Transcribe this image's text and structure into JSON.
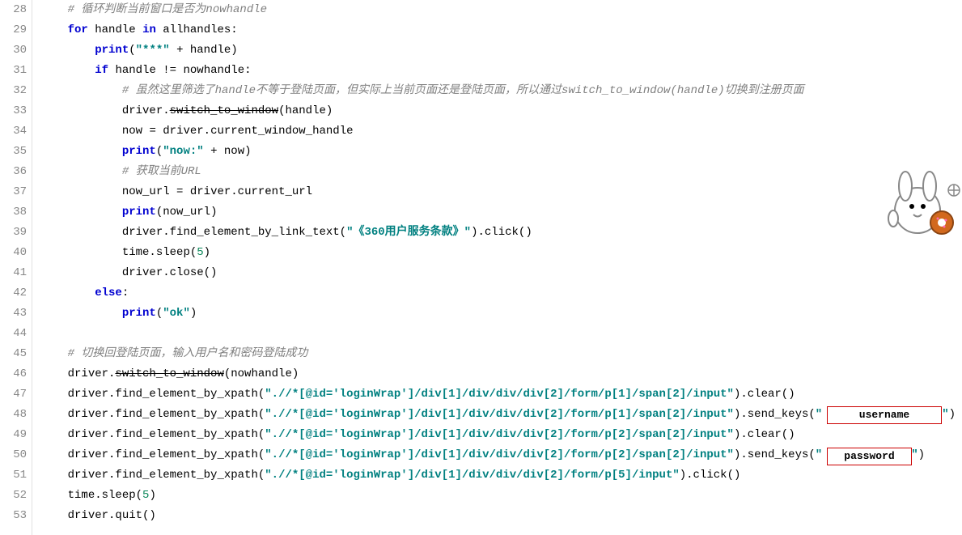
{
  "gutter_start": 28,
  "gutter_end": 53,
  "lines": {
    "l28": {
      "indent": 1,
      "tokens": [
        {
          "t": "comment",
          "v": "# 循环判断当前窗口是否为nowhandle"
        }
      ]
    },
    "l29": {
      "indent": 1,
      "tokens": [
        {
          "t": "kw",
          "v": "for"
        },
        {
          "t": "sp"
        },
        {
          "t": "ident",
          "v": "handle"
        },
        {
          "t": "sp"
        },
        {
          "t": "kw",
          "v": "in"
        },
        {
          "t": "sp"
        },
        {
          "t": "ident",
          "v": "allhandles:"
        }
      ]
    },
    "l30": {
      "indent": 2,
      "tokens": [
        {
          "t": "kw",
          "v": "print"
        },
        {
          "t": "paren",
          "v": "("
        },
        {
          "t": "str",
          "v": "\"***\""
        },
        {
          "t": "sp"
        },
        {
          "t": "op",
          "v": "+"
        },
        {
          "t": "sp"
        },
        {
          "t": "ident",
          "v": "handle"
        },
        {
          "t": "paren",
          "v": ")"
        }
      ]
    },
    "l31": {
      "indent": 2,
      "tokens": [
        {
          "t": "kw",
          "v": "if"
        },
        {
          "t": "sp"
        },
        {
          "t": "ident",
          "v": "handle"
        },
        {
          "t": "sp"
        },
        {
          "t": "op",
          "v": "!="
        },
        {
          "t": "sp"
        },
        {
          "t": "ident",
          "v": "nowhandle:"
        }
      ]
    },
    "l32": {
      "indent": 3,
      "tokens": [
        {
          "t": "comment",
          "v": "# 虽然这里筛选了handle不等于登陆页面，但实际上当前页面还是登陆页面，所以通过switch_to_window(handle)切换到注册页面"
        }
      ]
    },
    "l33": {
      "indent": 3,
      "tokens": [
        {
          "t": "ident",
          "v": "driver."
        },
        {
          "t": "strike",
          "v": "switch_to_window"
        },
        {
          "t": "paren",
          "v": "("
        },
        {
          "t": "ident",
          "v": "handle"
        },
        {
          "t": "paren",
          "v": ")"
        }
      ]
    },
    "l34": {
      "indent": 3,
      "tokens": [
        {
          "t": "ident",
          "v": "now"
        },
        {
          "t": "sp"
        },
        {
          "t": "op",
          "v": "="
        },
        {
          "t": "sp"
        },
        {
          "t": "ident",
          "v": "driver.current_window_handle"
        }
      ]
    },
    "l35": {
      "indent": 3,
      "tokens": [
        {
          "t": "kw",
          "v": "print"
        },
        {
          "t": "paren",
          "v": "("
        },
        {
          "t": "str",
          "v": "\"now:\""
        },
        {
          "t": "sp"
        },
        {
          "t": "op",
          "v": "+"
        },
        {
          "t": "sp"
        },
        {
          "t": "ident",
          "v": "now"
        },
        {
          "t": "paren",
          "v": ")"
        }
      ]
    },
    "l36": {
      "indent": 3,
      "tokens": [
        {
          "t": "comment",
          "v": "# 获取当前URL"
        }
      ]
    },
    "l37": {
      "indent": 3,
      "tokens": [
        {
          "t": "ident",
          "v": "now_url"
        },
        {
          "t": "sp"
        },
        {
          "t": "op",
          "v": "="
        },
        {
          "t": "sp"
        },
        {
          "t": "ident",
          "v": "driver.current_url"
        }
      ]
    },
    "l38": {
      "indent": 3,
      "tokens": [
        {
          "t": "kw",
          "v": "print"
        },
        {
          "t": "paren",
          "v": "("
        },
        {
          "t": "ident",
          "v": "now_url"
        },
        {
          "t": "paren",
          "v": ")"
        }
      ]
    },
    "l39": {
      "indent": 3,
      "tokens": [
        {
          "t": "ident",
          "v": "driver.find_element_by_link_text"
        },
        {
          "t": "paren",
          "v": "("
        },
        {
          "t": "str",
          "v": "\"《360用户服务条款》\""
        },
        {
          "t": "paren",
          "v": ")"
        },
        {
          "t": "ident",
          "v": ".click"
        },
        {
          "t": "paren",
          "v": "()"
        }
      ]
    },
    "l40": {
      "indent": 3,
      "tokens": [
        {
          "t": "ident",
          "v": "time.sleep"
        },
        {
          "t": "paren",
          "v": "("
        },
        {
          "t": "num",
          "v": "5"
        },
        {
          "t": "paren",
          "v": ")"
        }
      ]
    },
    "l41": {
      "indent": 3,
      "tokens": [
        {
          "t": "ident",
          "v": "driver.close"
        },
        {
          "t": "paren",
          "v": "()"
        }
      ]
    },
    "l42": {
      "indent": 2,
      "tokens": [
        {
          "t": "kw",
          "v": "else"
        },
        {
          "t": "ident",
          "v": ":"
        }
      ]
    },
    "l43": {
      "indent": 3,
      "tokens": [
        {
          "t": "kw",
          "v": "print"
        },
        {
          "t": "paren",
          "v": "("
        },
        {
          "t": "str",
          "v": "\"ok\""
        },
        {
          "t": "paren",
          "v": ")"
        }
      ]
    },
    "l44": {
      "indent": 0,
      "tokens": []
    },
    "l45": {
      "indent": 1,
      "tokens": [
        {
          "t": "comment",
          "v": "# 切换回登陆页面，输入用户名和密码登陆成功"
        }
      ]
    },
    "l46": {
      "indent": 1,
      "tokens": [
        {
          "t": "ident",
          "v": "driver."
        },
        {
          "t": "strike",
          "v": "switch_to_window"
        },
        {
          "t": "paren",
          "v": "("
        },
        {
          "t": "ident",
          "v": "nowhandle"
        },
        {
          "t": "paren",
          "v": ")"
        }
      ]
    },
    "l47": {
      "indent": 1,
      "tokens": [
        {
          "t": "ident",
          "v": "driver.find_element_by_xpath"
        },
        {
          "t": "paren",
          "v": "("
        },
        {
          "t": "str",
          "v": "\".//*[@id='loginWrap']/div[1]/div/div/div[2]/form/p[1]/span[2]/input\""
        },
        {
          "t": "paren",
          "v": ")"
        },
        {
          "t": "ident",
          "v": ".clear"
        },
        {
          "t": "paren",
          "v": "()"
        }
      ]
    },
    "l48": {
      "indent": 1,
      "tokens": [
        {
          "t": "ident",
          "v": "driver.find_element_by_xpath"
        },
        {
          "t": "paren",
          "v": "("
        },
        {
          "t": "str",
          "v": "\".//*[@id='loginWrap']/div[1]/div/div/div[2]/form/p[1]/span[2]/input\""
        },
        {
          "t": "paren",
          "v": ")"
        },
        {
          "t": "ident",
          "v": ".send_keys"
        },
        {
          "t": "paren",
          "v": "("
        },
        {
          "t": "str",
          "v": "\""
        },
        {
          "t": "gap",
          "w": 148
        },
        {
          "t": "str",
          "v": "\""
        },
        {
          "t": "paren",
          "v": ")"
        }
      ]
    },
    "l49": {
      "indent": 1,
      "tokens": [
        {
          "t": "ident",
          "v": "driver.find_element_by_xpath"
        },
        {
          "t": "paren",
          "v": "("
        },
        {
          "t": "str",
          "v": "\".//*[@id='loginWrap']/div[1]/div/div/div[2]/form/p[2]/span[2]/input\""
        },
        {
          "t": "paren",
          "v": ")"
        },
        {
          "t": "ident",
          "v": ".clear"
        },
        {
          "t": "paren",
          "v": "()"
        }
      ]
    },
    "l50": {
      "indent": 1,
      "tokens": [
        {
          "t": "ident",
          "v": "driver.find_element_by_xpath"
        },
        {
          "t": "paren",
          "v": "("
        },
        {
          "t": "str",
          "v": "\".//*[@id='loginWrap']/div[1]/div/div/div[2]/form/p[2]/span[2]/input\""
        },
        {
          "t": "paren",
          "v": ")"
        },
        {
          "t": "ident",
          "v": ".send_keys"
        },
        {
          "t": "paren",
          "v": "("
        },
        {
          "t": "str",
          "v": "\""
        },
        {
          "t": "gap",
          "w": 110
        },
        {
          "t": "str",
          "v": "\""
        },
        {
          "t": "paren",
          "v": ")"
        }
      ]
    },
    "l51": {
      "indent": 1,
      "tokens": [
        {
          "t": "ident",
          "v": "driver.find_element_by_xpath"
        },
        {
          "t": "paren",
          "v": "("
        },
        {
          "t": "str",
          "v": "\".//*[@id='loginWrap']/div[1]/div/div/div[2]/form/p[5]/input\""
        },
        {
          "t": "paren",
          "v": ")"
        },
        {
          "t": "ident",
          "v": ".click"
        },
        {
          "t": "paren",
          "v": "()"
        }
      ]
    },
    "l52": {
      "indent": 1,
      "tokens": [
        {
          "t": "ident",
          "v": "time.sleep"
        },
        {
          "t": "paren",
          "v": "("
        },
        {
          "t": "num",
          "v": "5"
        },
        {
          "t": "paren",
          "v": ")"
        }
      ]
    },
    "l53": {
      "indent": 1,
      "tokens": [
        {
          "t": "ident",
          "v": "driver.quit"
        },
        {
          "t": "paren",
          "v": "()"
        }
      ]
    }
  },
  "badges": {
    "username": "username",
    "password": "password"
  }
}
